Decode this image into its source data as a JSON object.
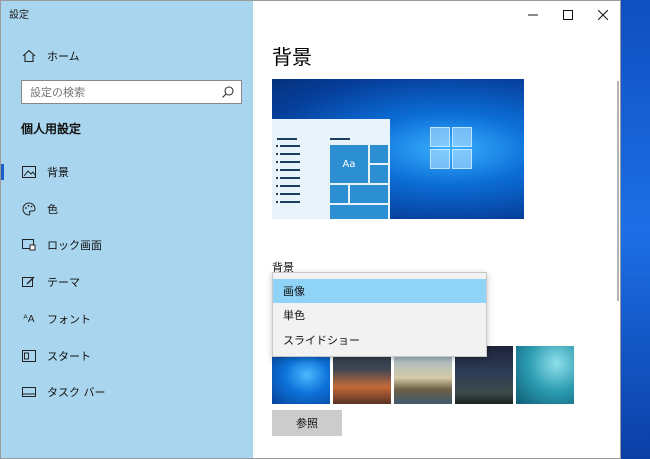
{
  "window": {
    "title": "設定"
  },
  "titlebar": {
    "minimize": "─",
    "maximize": "☐",
    "close": "✕"
  },
  "sidebar": {
    "home_label": "ホーム",
    "search_placeholder": "設定の検索",
    "section_title": "個人用設定",
    "items": [
      {
        "label": "背景",
        "icon": "image-icon",
        "active": true
      },
      {
        "label": "色",
        "icon": "palette-icon",
        "active": false
      },
      {
        "label": "ロック画面",
        "icon": "lock-screen-icon",
        "active": false
      },
      {
        "label": "テーマ",
        "icon": "theme-icon",
        "active": false
      },
      {
        "label": "フォント",
        "icon": "font-icon",
        "active": false
      },
      {
        "label": "スタート",
        "icon": "start-icon",
        "active": false
      },
      {
        "label": "タスク バー",
        "icon": "taskbar-icon",
        "active": false
      }
    ]
  },
  "main": {
    "page_title": "背景",
    "preview_tile_text": "Aa",
    "background_label": "背景",
    "dropdown": {
      "options": [
        "画像",
        "単色",
        "スライドショー"
      ],
      "selected": "画像"
    },
    "browse_label": "参照"
  },
  "colors": {
    "sidebar_bg": "#a9d6ee",
    "accent": "#1a5fc8",
    "dropdown_selected": "#8fd3f7"
  }
}
